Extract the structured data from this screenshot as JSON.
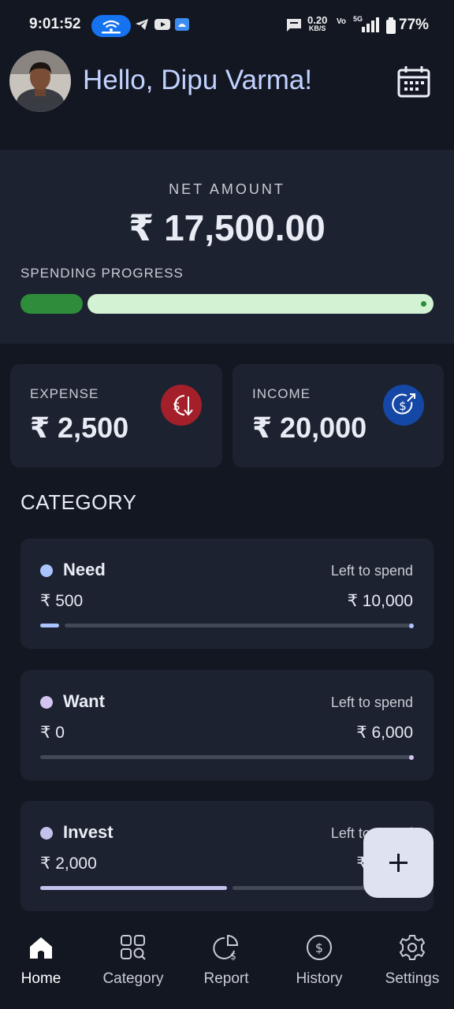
{
  "status_bar": {
    "time": "9:01:52",
    "net_speed_value": "0.20",
    "net_speed_unit": "KB/S",
    "volte": "Vo",
    "network": "5G",
    "battery_pct": "77%"
  },
  "header": {
    "greeting": "Hello, Dipu Varma!",
    "avatar_icon": "user-avatar",
    "calendar_icon": "calendar-icon"
  },
  "net": {
    "label": "NET AMOUNT",
    "value": "₹ 17,500.00",
    "spending_label": "SPENDING PROGRESS",
    "spent_fraction": 0.125,
    "used_color": "#2e8d3a",
    "remaining_color": "#d2f2d3"
  },
  "summary": {
    "expense": {
      "label": "EXPENSE",
      "value": "₹ 2,500",
      "color": "#a3202a",
      "icon": "dollar-down-icon"
    },
    "income": {
      "label": "INCOME",
      "value": "₹ 20,000",
      "color": "#1547a6",
      "icon": "dollar-up-icon"
    }
  },
  "category": {
    "title": "CATEGORY",
    "items": [
      {
        "name": "Need",
        "left_label": "Left to spend",
        "spent": "₹ 500",
        "remaining": "₹ 10,000",
        "progress": 0.05,
        "color": "#aac4ff"
      },
      {
        "name": "Want",
        "left_label": "Left to spend",
        "spent": "₹ 0",
        "remaining": "₹ 6,000",
        "progress": 0,
        "color": "#d4c4f2"
      },
      {
        "name": "Invest",
        "left_label": "Left to spend",
        "spent": "₹ 2,000",
        "remaining": "₹ 2,000",
        "progress": 0.5,
        "color": "#c4c2ec"
      }
    ]
  },
  "fab": {
    "icon": "plus-icon"
  },
  "nav": {
    "items": [
      {
        "label": "Home",
        "icon": "home-icon",
        "active": true
      },
      {
        "label": "Category",
        "icon": "category-icon",
        "active": false
      },
      {
        "label": "Report",
        "icon": "report-icon",
        "active": false
      },
      {
        "label": "History",
        "icon": "history-icon",
        "active": false
      },
      {
        "label": "Settings",
        "icon": "settings-icon",
        "active": false
      }
    ]
  }
}
